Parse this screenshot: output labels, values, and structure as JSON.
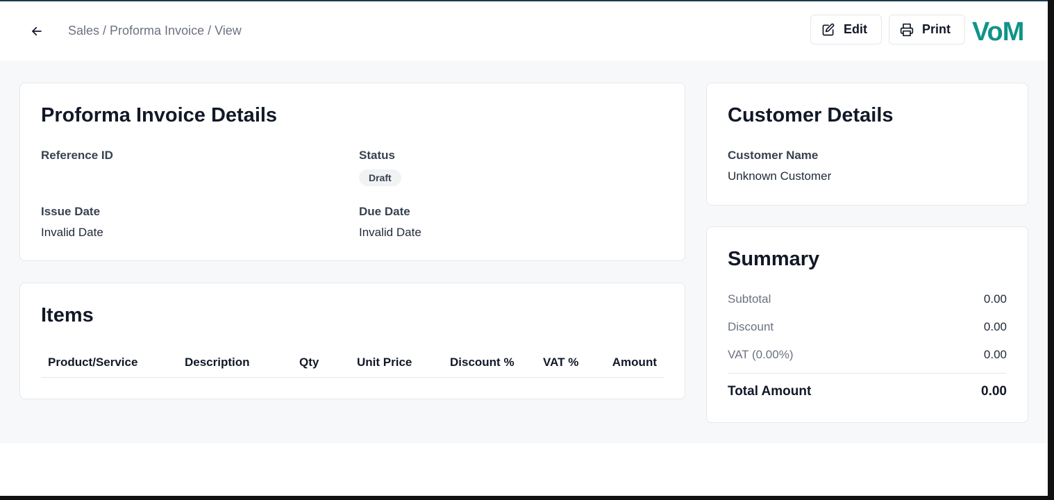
{
  "header": {
    "breadcrumb": "Sales / Proforma Invoice / View",
    "edit_label": "Edit",
    "print_label": "Print",
    "logo": "VoM",
    "logo_color": "#0f9488"
  },
  "invoice_details": {
    "title": "Proforma Invoice Details",
    "reference_id_label": "Reference ID",
    "reference_id_value": "",
    "status_label": "Status",
    "status_value": "Draft",
    "issue_date_label": "Issue Date",
    "issue_date_value": "Invalid Date",
    "due_date_label": "Due Date",
    "due_date_value": "Invalid Date"
  },
  "items": {
    "title": "Items",
    "columns": [
      "Product/Service",
      "Description",
      "Qty",
      "Unit Price",
      "Discount %",
      "VAT %",
      "Amount"
    ]
  },
  "customer": {
    "title": "Customer Details",
    "name_label": "Customer Name",
    "name_value": "Unknown Customer"
  },
  "summary": {
    "title": "Summary",
    "subtotal_label": "Subtotal",
    "subtotal_value": "0.00",
    "discount_label": "Discount",
    "discount_value": "0.00",
    "vat_label": "VAT (0.00%)",
    "vat_value": "0.00",
    "total_label": "Total Amount",
    "total_value": "0.00"
  },
  "icons": {
    "back": "arrow-left-icon",
    "edit": "pencil-square-icon",
    "print": "printer-icon"
  }
}
